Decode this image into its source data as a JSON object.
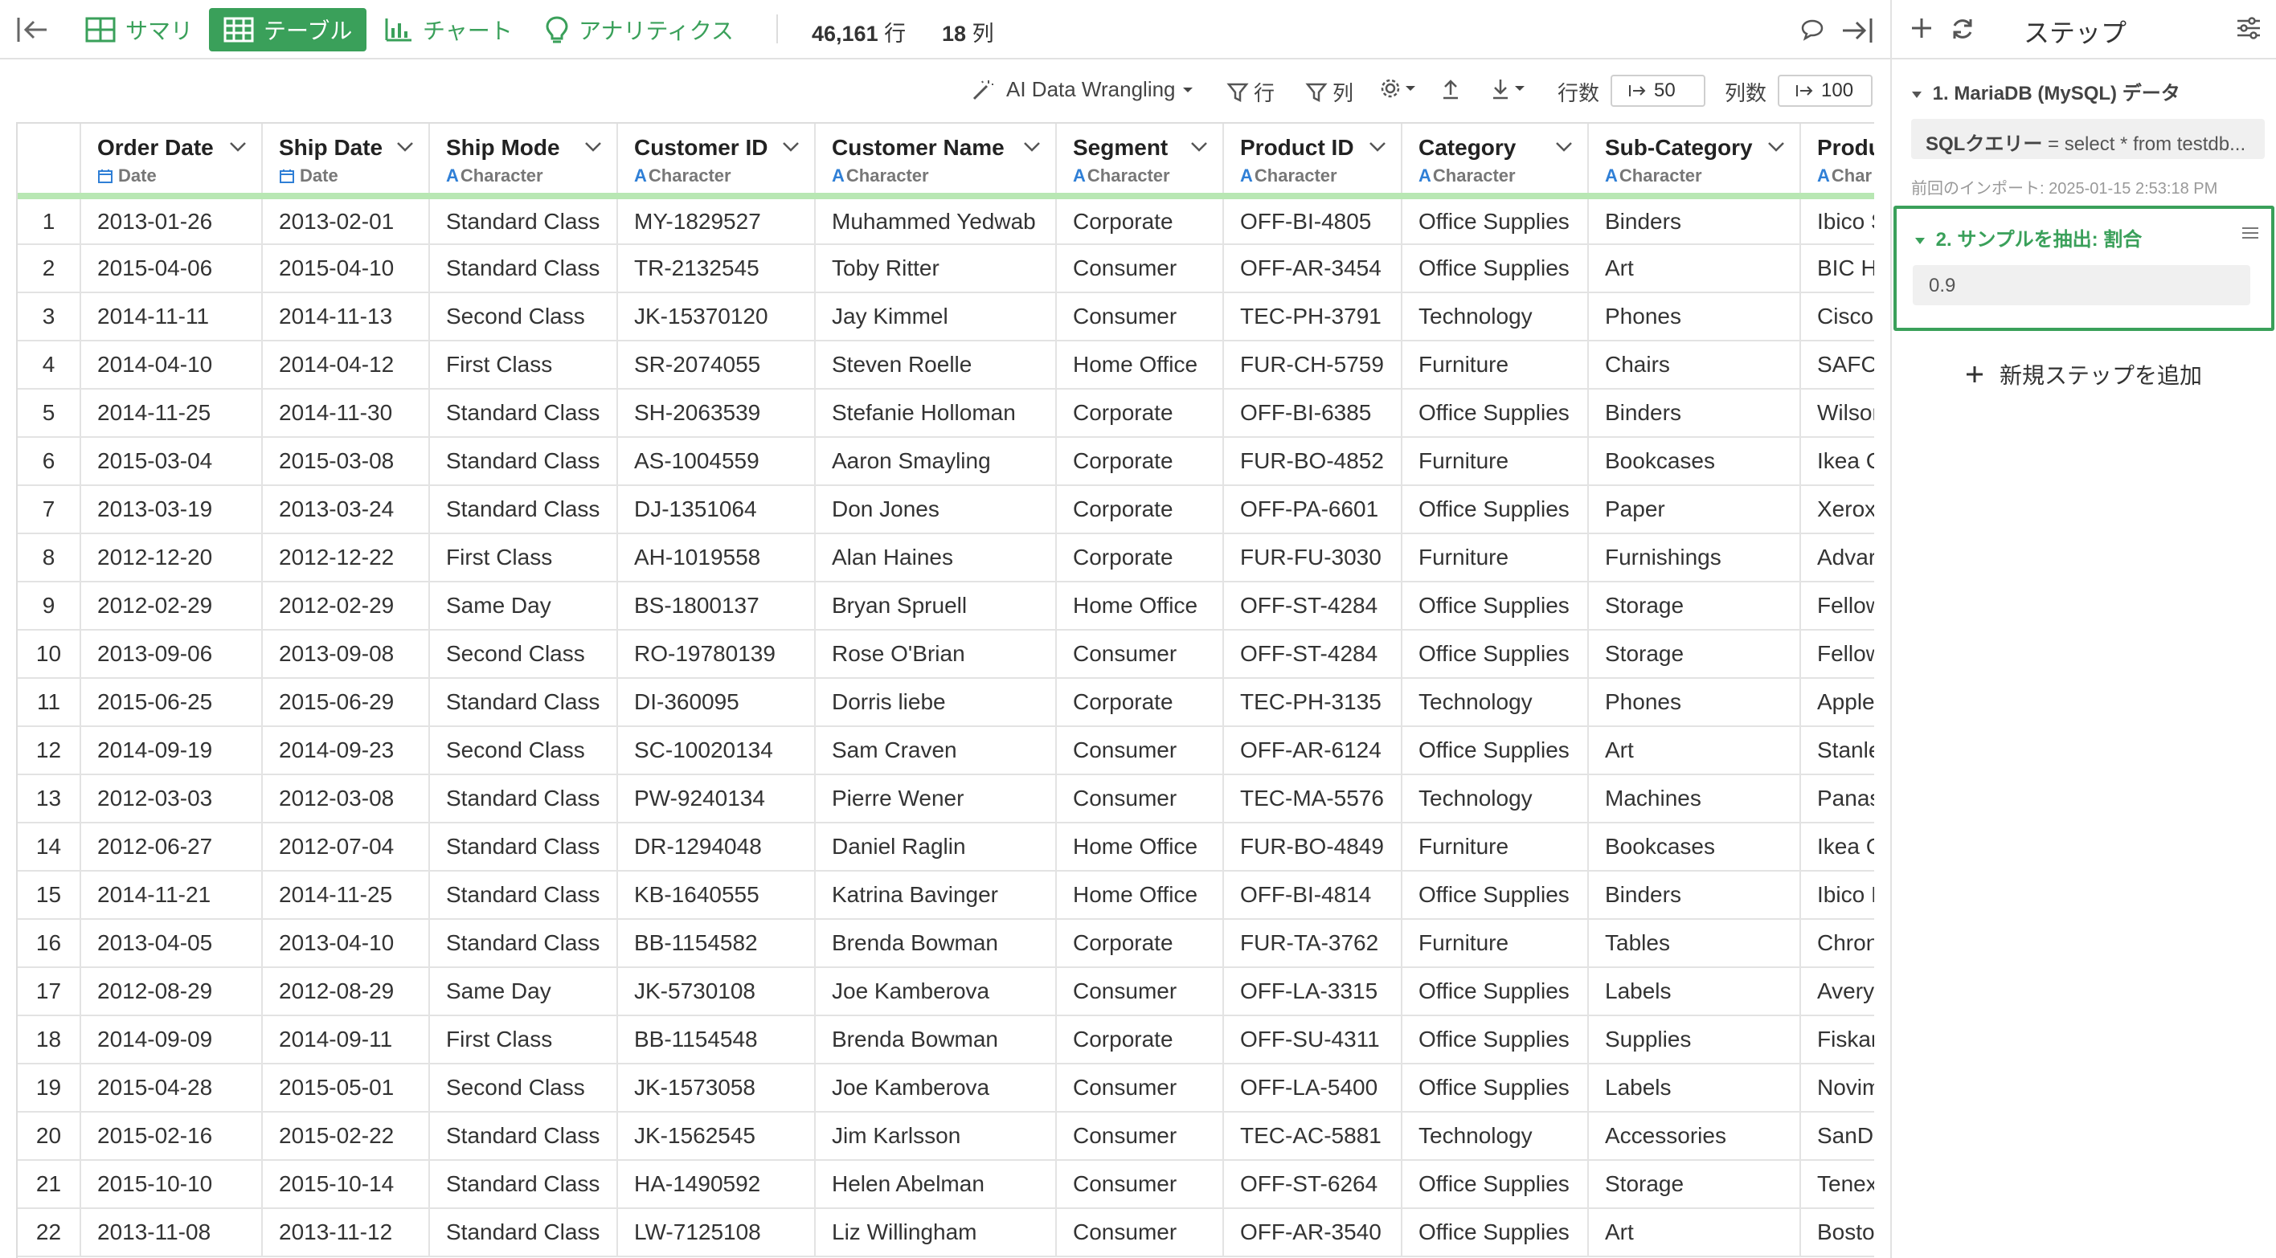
{
  "toolbar": {
    "tabs": [
      {
        "label": "サマリ",
        "icon": "summary-grid-icon"
      },
      {
        "label": "テーブル",
        "icon": "table-icon",
        "active": true
      },
      {
        "label": "チャート",
        "icon": "bar-chart-icon"
      },
      {
        "label": "アナリティクス",
        "icon": "lightbulb-icon"
      }
    ],
    "rows_count": "46,161",
    "rows_unit": "行",
    "cols_count": "18",
    "cols_unit": "列"
  },
  "subbar": {
    "ai_label": "AI Data Wrangling",
    "row_filter": "行",
    "col_filter": "列",
    "rows_label": "行数",
    "rows_value": "50",
    "cols_label": "列数",
    "cols_value": "100"
  },
  "table": {
    "columns": [
      {
        "name": "Order Date",
        "type": "Date"
      },
      {
        "name": "Ship Date",
        "type": "Date"
      },
      {
        "name": "Ship Mode",
        "type": "Character"
      },
      {
        "name": "Customer ID",
        "type": "Character"
      },
      {
        "name": "Customer Name",
        "type": "Character"
      },
      {
        "name": "Segment",
        "type": "Character"
      },
      {
        "name": "Product ID",
        "type": "Character"
      },
      {
        "name": "Category",
        "type": "Character"
      },
      {
        "name": "Sub-Category",
        "type": "Character"
      },
      {
        "name": "Produ",
        "type": "Char"
      }
    ],
    "rows": [
      [
        "1",
        "2013-01-26",
        "2013-02-01",
        "Standard Class",
        "MY-1829527",
        "Muhammed Yedwab",
        "Corporate",
        "OFF-BI-4805",
        "Office Supplies",
        "Binders",
        "Ibico S"
      ],
      [
        "2",
        "2015-04-06",
        "2015-04-10",
        "Standard Class",
        "TR-2132545",
        "Toby Ritter",
        "Consumer",
        "OFF-AR-3454",
        "Office Supplies",
        "Art",
        "BIC H"
      ],
      [
        "3",
        "2014-11-11",
        "2014-11-13",
        "Second Class",
        "JK-15370120",
        "Jay Kimmel",
        "Consumer",
        "TEC-PH-3791",
        "Technology",
        "Phones",
        "Cisco"
      ],
      [
        "4",
        "2014-04-10",
        "2014-04-12",
        "First Class",
        "SR-2074055",
        "Steven Roelle",
        "Home Office",
        "FUR-CH-5759",
        "Furniture",
        "Chairs",
        "SAFC"
      ],
      [
        "5",
        "2014-11-25",
        "2014-11-30",
        "Standard Class",
        "SH-2063539",
        "Stefanie Holloman",
        "Corporate",
        "OFF-BI-6385",
        "Office Supplies",
        "Binders",
        "Wilsor"
      ],
      [
        "6",
        "2015-03-04",
        "2015-03-08",
        "Standard Class",
        "AS-1004559",
        "Aaron Smayling",
        "Corporate",
        "FUR-BO-4852",
        "Furniture",
        "Bookcases",
        "Ikea C"
      ],
      [
        "7",
        "2013-03-19",
        "2013-03-24",
        "Standard Class",
        "DJ-1351064",
        "Don Jones",
        "Corporate",
        "OFF-PA-6601",
        "Office Supplies",
        "Paper",
        "Xerox"
      ],
      [
        "8",
        "2012-12-20",
        "2012-12-22",
        "First Class",
        "AH-1019558",
        "Alan Haines",
        "Corporate",
        "FUR-FU-3030",
        "Furniture",
        "Furnishings",
        "Advar"
      ],
      [
        "9",
        "2012-02-29",
        "2012-02-29",
        "Same Day",
        "BS-1800137",
        "Bryan Spruell",
        "Home Office",
        "OFF-ST-4284",
        "Office Supplies",
        "Storage",
        "Fellow"
      ],
      [
        "10",
        "2013-09-06",
        "2013-09-08",
        "Second Class",
        "RO-19780139",
        "Rose O'Brian",
        "Consumer",
        "OFF-ST-4284",
        "Office Supplies",
        "Storage",
        "Fellow"
      ],
      [
        "11",
        "2015-06-25",
        "2015-06-29",
        "Standard Class",
        "DI-360095",
        "Dorris liebe",
        "Corporate",
        "TEC-PH-3135",
        "Technology",
        "Phones",
        "Apple"
      ],
      [
        "12",
        "2014-09-19",
        "2014-09-23",
        "Second Class",
        "SC-10020134",
        "Sam Craven",
        "Consumer",
        "OFF-AR-6124",
        "Office Supplies",
        "Art",
        "Stanle"
      ],
      [
        "13",
        "2012-03-03",
        "2012-03-08",
        "Standard Class",
        "PW-9240134",
        "Pierre Wener",
        "Consumer",
        "TEC-MA-5576",
        "Technology",
        "Machines",
        "Panas"
      ],
      [
        "14",
        "2012-06-27",
        "2012-07-04",
        "Standard Class",
        "DR-1294048",
        "Daniel Raglin",
        "Home Office",
        "FUR-BO-4849",
        "Furniture",
        "Bookcases",
        "Ikea C"
      ],
      [
        "15",
        "2014-11-21",
        "2014-11-25",
        "Standard Class",
        "KB-1640555",
        "Katrina Bavinger",
        "Home Office",
        "OFF-BI-4814",
        "Office Supplies",
        "Binders",
        "Ibico I"
      ],
      [
        "16",
        "2013-04-05",
        "2013-04-10",
        "Standard Class",
        "BB-1154582",
        "Brenda Bowman",
        "Corporate",
        "FUR-TA-3762",
        "Furniture",
        "Tables",
        "Chron"
      ],
      [
        "17",
        "2012-08-29",
        "2012-08-29",
        "Same Day",
        "JK-5730108",
        "Joe Kamberova",
        "Consumer",
        "OFF-LA-3315",
        "Office Supplies",
        "Labels",
        "Avery"
      ],
      [
        "18",
        "2014-09-09",
        "2014-09-11",
        "First Class",
        "BB-1154548",
        "Brenda Bowman",
        "Corporate",
        "OFF-SU-4311",
        "Office Supplies",
        "Supplies",
        "Fiskar"
      ],
      [
        "19",
        "2015-04-28",
        "2015-05-01",
        "Second Class",
        "JK-1573058",
        "Joe Kamberova",
        "Consumer",
        "OFF-LA-5400",
        "Office Supplies",
        "Labels",
        "Novim"
      ],
      [
        "20",
        "2015-02-16",
        "2015-02-22",
        "Standard Class",
        "JK-1562545",
        "Jim Karlsson",
        "Consumer",
        "TEC-AC-5881",
        "Technology",
        "Accessories",
        "SanDi"
      ],
      [
        "21",
        "2015-10-10",
        "2015-10-14",
        "Standard Class",
        "HA-1490592",
        "Helen Abelman",
        "Consumer",
        "OFF-ST-6264",
        "Office Supplies",
        "Storage",
        "Tenex"
      ],
      [
        "22",
        "2013-11-08",
        "2013-11-12",
        "Standard Class",
        "LW-7125108",
        "Liz Willingham",
        "Consumer",
        "OFF-AR-3540",
        "Office Supplies",
        "Art",
        "Bosto"
      ]
    ]
  },
  "panel": {
    "title": "ステップ",
    "step1_title": "1. MariaDB (MySQL) データ",
    "sql_label": "SQLクエリー",
    "sql_value": " = select * from testdb...",
    "import_ts": "前回のインポート: 2025-01-15 2:53:18 PM",
    "step2_title": "2. サンプルを抽出: 割合",
    "step2_value": "0.9",
    "add_step": "新規ステップを追加"
  },
  "colors": {
    "accent": "#3aa05a",
    "header_underline": "#b8e7b3",
    "type_icon": "#2f7fd6"
  }
}
